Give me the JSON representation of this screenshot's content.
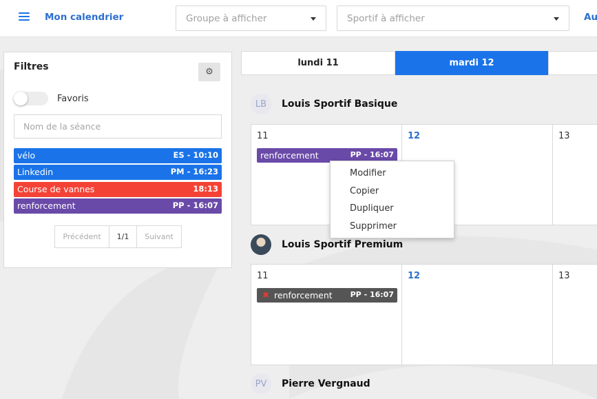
{
  "header": {
    "title": "Mon calendrier",
    "group_select": {
      "placeholder": "Groupe à afficher"
    },
    "athlete_select": {
      "placeholder": "Sportif à afficher"
    },
    "today_link": "Au"
  },
  "filters": {
    "title": "Filtres",
    "favorites_label": "Favoris",
    "favorites_on": false,
    "session_name_placeholder": "Nom de la séance",
    "items": [
      {
        "name": "vélo",
        "code": "ES - 10:10",
        "color": "#1a73e8"
      },
      {
        "name": "Linkedin",
        "code": "PM - 16:23",
        "color": "#1a73e8"
      },
      {
        "name": "Course de vannes",
        "code": "18:13",
        "color": "#f44336"
      },
      {
        "name": "renforcement",
        "code": "PP - 16:07",
        "color": "#6a4aa8"
      }
    ],
    "pagination": {
      "prev": "Précédent",
      "page": "1/1",
      "next": "Suivant"
    }
  },
  "days": {
    "mon": "lundi 11",
    "tue": "mardi 12",
    "wed": ""
  },
  "athletes": [
    {
      "initials": "LB",
      "name": "Louis Sportif Basique",
      "dates": [
        "11",
        "12",
        "13"
      ],
      "event": {
        "name": "renforcement",
        "code": "PP - 16:07",
        "color": "#6a4aa8"
      }
    },
    {
      "initials": "",
      "name": "Louis Sportif Premium",
      "dates": [
        "11",
        "12",
        "13"
      ],
      "event": {
        "name": "renforcement",
        "code": "PP - 16:07",
        "color": "#555555"
      }
    },
    {
      "initials": "PV",
      "name": "Pierre Vergnaud"
    }
  ],
  "context_menu": {
    "items": [
      "Modifier",
      "Copier",
      "Dupliquer",
      "Supprimer"
    ]
  },
  "colors": {
    "accent": "#1a73e8",
    "title_blue": "#2c6fd1",
    "danger": "#f44336",
    "purple": "#6a4aa8"
  }
}
